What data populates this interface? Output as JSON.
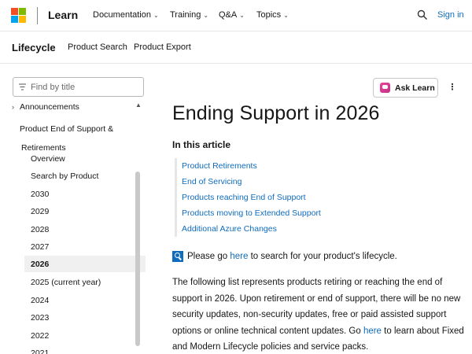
{
  "header": {
    "brand": "Learn",
    "nav": [
      {
        "label": "Documentation"
      },
      {
        "label": "Training"
      },
      {
        "label": "Q&A"
      },
      {
        "label": "Topics"
      }
    ],
    "sign_in": "Sign in",
    "icons": {
      "logo": "microsoft-logo",
      "search": "search-icon"
    }
  },
  "subnav": {
    "title": "Lifecycle",
    "links": [
      {
        "label": "Product Search"
      },
      {
        "label": "Product Export"
      }
    ]
  },
  "sidebar": {
    "filter_placeholder": "Find by title",
    "items": [
      {
        "label": "Announcements",
        "arrow": ">"
      },
      {
        "label": "Product End of Support & Retirements",
        "arrow": "v"
      }
    ],
    "subitems": [
      {
        "label": "Overview"
      },
      {
        "label": "Search by Product"
      },
      {
        "label": "2030"
      },
      {
        "label": "2029"
      },
      {
        "label": "2028"
      },
      {
        "label": "2027"
      },
      {
        "label": "2026",
        "selected": true
      },
      {
        "label": "2025 (current year)"
      },
      {
        "label": "2024"
      },
      {
        "label": "2023"
      },
      {
        "label": "2022"
      },
      {
        "label": "2021"
      }
    ]
  },
  "toolbar": {
    "ask_learn": "Ask Learn",
    "more": "⋮"
  },
  "article": {
    "title": "Ending Support in 2026",
    "in_this_article": "In this article",
    "toc": [
      {
        "label": "Product Retirements"
      },
      {
        "label": "End of Servicing"
      },
      {
        "label": "Products reaching End of Support"
      },
      {
        "label": "Products moving to Extended Support"
      },
      {
        "label": "Additional Azure Changes"
      }
    ],
    "note": {
      "before": "Please go ",
      "link": "here",
      "after": " to search for your product's lifecycle."
    },
    "paragraph": {
      "text": "The following list represents products retiring or reaching the end of support in 2026. Upon retirement or end of support, there will be no new security updates, non-security updates, free or paid assisted support options or online technical content updates. Go ",
      "link": "here",
      "after": " to learn about Fixed and Modern Lifecycle policies and service packs."
    }
  },
  "colors": {
    "link": "#0f6cbd",
    "selected_bg": "#f0f0f0",
    "ask_learn_accent": "#e8429e"
  }
}
